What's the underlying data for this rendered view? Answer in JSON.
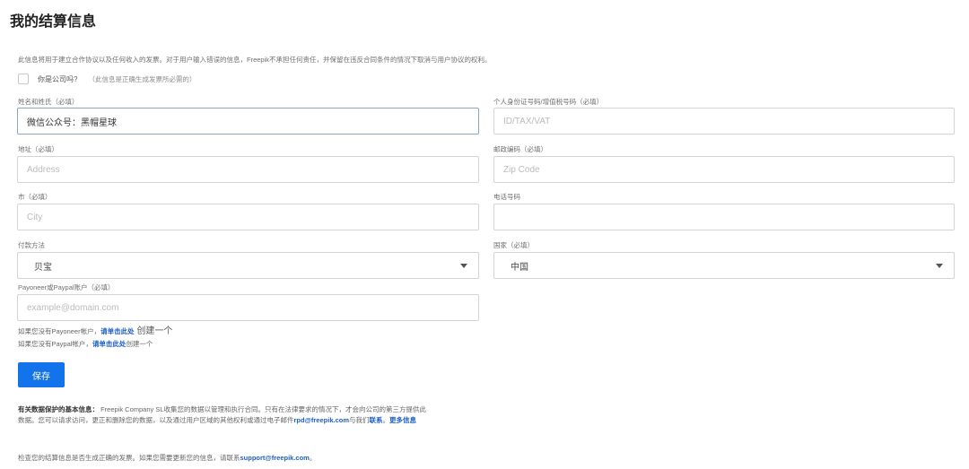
{
  "page": {
    "title": "我的结算信息",
    "intro": "此信息将用于建立合作协议以及任何收入的发票。对于用户输入错误的信息，Freepik不承担任何责任，并保留在违反合同条件的情况下取消与用户协议的权利。"
  },
  "company_check": {
    "label": "你是公司吗?",
    "hint": "（此信息是正确生成发票所必需的）"
  },
  "form": {
    "name": {
      "label": "姓名和姓氏（必填）",
      "value": "微信公众号：黑帽星球"
    },
    "tax_id": {
      "label": "个人身份证号码/增值税号码（必填）",
      "placeholder": "ID/TAX/VAT"
    },
    "address": {
      "label": "地址（必填）",
      "placeholder": "Address"
    },
    "zip": {
      "label": "邮政编码（必填）",
      "placeholder": "Zip Code"
    },
    "city": {
      "label": "市（必填）",
      "placeholder": "City"
    },
    "phone": {
      "label": "电话号码",
      "placeholder": ""
    },
    "payment": {
      "label": "付款方法",
      "value": "贝宝"
    },
    "country": {
      "label": "国家（必填）",
      "value": "中国"
    },
    "account": {
      "label": "Payoneer或Paypal账户（必填）",
      "placeholder": "example@domain.com"
    }
  },
  "links": {
    "payoneer_prefix": "如果您没有Payoneer帐户，",
    "payoneer_link": "请单击此处",
    "payoneer_suffix": " 创建一个",
    "paypal_prefix": "如果您没有Paypal帐户，",
    "paypal_link": "请单击此处",
    "paypal_suffix": "创建一个"
  },
  "save_label": "保存",
  "privacy": {
    "heading": "有关数据保护的基本信息：",
    "text1": " Freepik Company SL收集您的数据以管理和执行合同。只有在法律要求的情况下，才会向公司的第三方提供此数据。您可以请求访问，更正和删除您的数据，以及通过用户区域的其他权利或通过电子邮件",
    "email": "rpd@freepik.com",
    "text2": "与我们",
    "contact_link": "联系",
    "text3": "。",
    "more_link": "更多信息"
  },
  "footer": {
    "text": "检查您的结算信息是否生成正确的发票。如果您需要更新您的信息，请联系",
    "email": "support@freepik.com",
    "end": "。"
  },
  "colors": {
    "primary": "#1273eb",
    "link": "#1b5fc7",
    "active_border": "#8aa6c0"
  }
}
